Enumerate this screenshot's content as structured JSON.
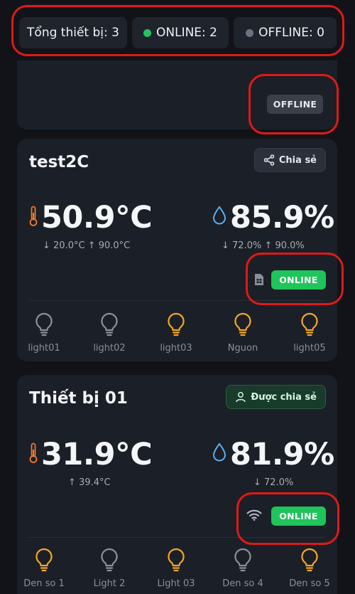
{
  "summary": {
    "total_label": "Tổng thiết bị: 3",
    "online_label": "ONLINE: 2",
    "offline_label": "OFFLINE: 0",
    "online_color": "#22c55e",
    "offline_color": "#6b7280"
  },
  "top_card": {
    "status": "OFFLINE"
  },
  "devices": [
    {
      "name": "test2C",
      "share_label": "Chia sẻ",
      "share_icon": "share-icon",
      "temperature": "50.9°C",
      "temperature_range": "↓ 20.0°C ↑ 90.0°C",
      "humidity": "85.9%",
      "humidity_range": "↓ 72.0% ↑ 90.0%",
      "connection_icon": "sim-card-icon",
      "status": "ONLINE",
      "lights": [
        {
          "label": "light01",
          "on": false
        },
        {
          "label": "light02",
          "on": false
        },
        {
          "label": "light03",
          "on": true
        },
        {
          "label": "Nguon",
          "on": true
        },
        {
          "label": "light05",
          "on": true
        }
      ]
    },
    {
      "name": "Thiết bị 01",
      "share_label": "Được chia sẻ",
      "share_icon": "user-icon",
      "temperature": "31.9°C",
      "temperature_range": "↑ 39.4°C",
      "humidity": "81.9%",
      "humidity_range": "↓ 72.0%",
      "connection_icon": "wifi-icon",
      "status": "ONLINE",
      "lights": [
        {
          "label": "Den so 1",
          "on": true
        },
        {
          "label": "Light 2",
          "on": false
        },
        {
          "label": "Light 03",
          "on": true
        },
        {
          "label": "Den so 4",
          "on": false
        },
        {
          "label": "Den so 5",
          "on": true
        }
      ]
    }
  ],
  "colors": {
    "bulb_on": "#f5a623",
    "bulb_off": "#8a909a",
    "thermometer": "#f07b2b",
    "droplet": "#5ab0f0",
    "annotation": "#e01919"
  }
}
